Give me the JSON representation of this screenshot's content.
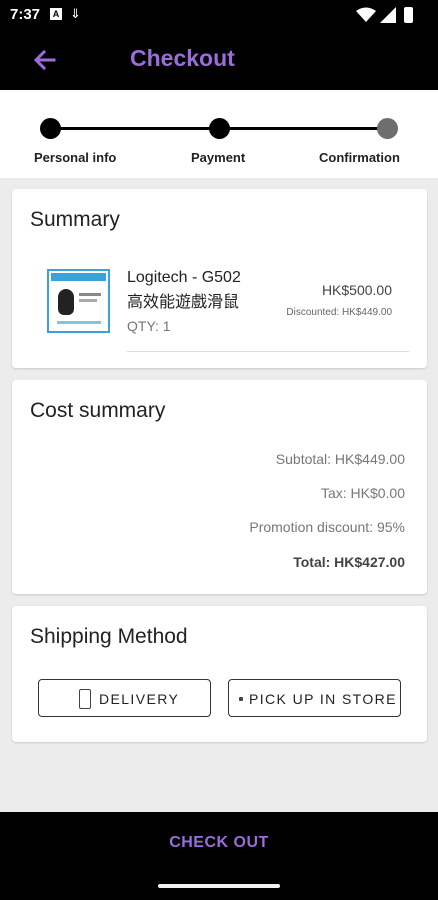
{
  "status_bar": {
    "time": "7:37",
    "icon_a": "A",
    "icon_b": "⇓"
  },
  "app_bar": {
    "title": "Checkout"
  },
  "stepper": {
    "steps": [
      {
        "label": "Personal info",
        "state": "done"
      },
      {
        "label": "Payment",
        "state": "current"
      },
      {
        "label": "Confirmation",
        "state": "upcoming"
      }
    ]
  },
  "summary": {
    "title": "Summary",
    "item": {
      "name": "Logitech - G502 高效能遊戲滑鼠",
      "qty": "QTY: 1",
      "price": "HK$500.00",
      "discounted": "Discounted: HK$449.00"
    }
  },
  "cost_summary": {
    "title": "Cost summary",
    "subtotal": "Subtotal: HK$449.00",
    "tax": "Tax: HK$0.00",
    "promotion": "Promotion discount: 95%",
    "total": "Total: HK$427.00"
  },
  "shipping": {
    "title": "Shipping Method",
    "delivery_label": "DELIVERY",
    "pickup_label": "PICK UP IN STORE"
  },
  "bottom": {
    "checkout_label": "CHECK OUT"
  },
  "colors": {
    "accent": "#9b6cdc",
    "bar": "#000000",
    "background": "#ececec",
    "image_border": "#39a2d9"
  }
}
